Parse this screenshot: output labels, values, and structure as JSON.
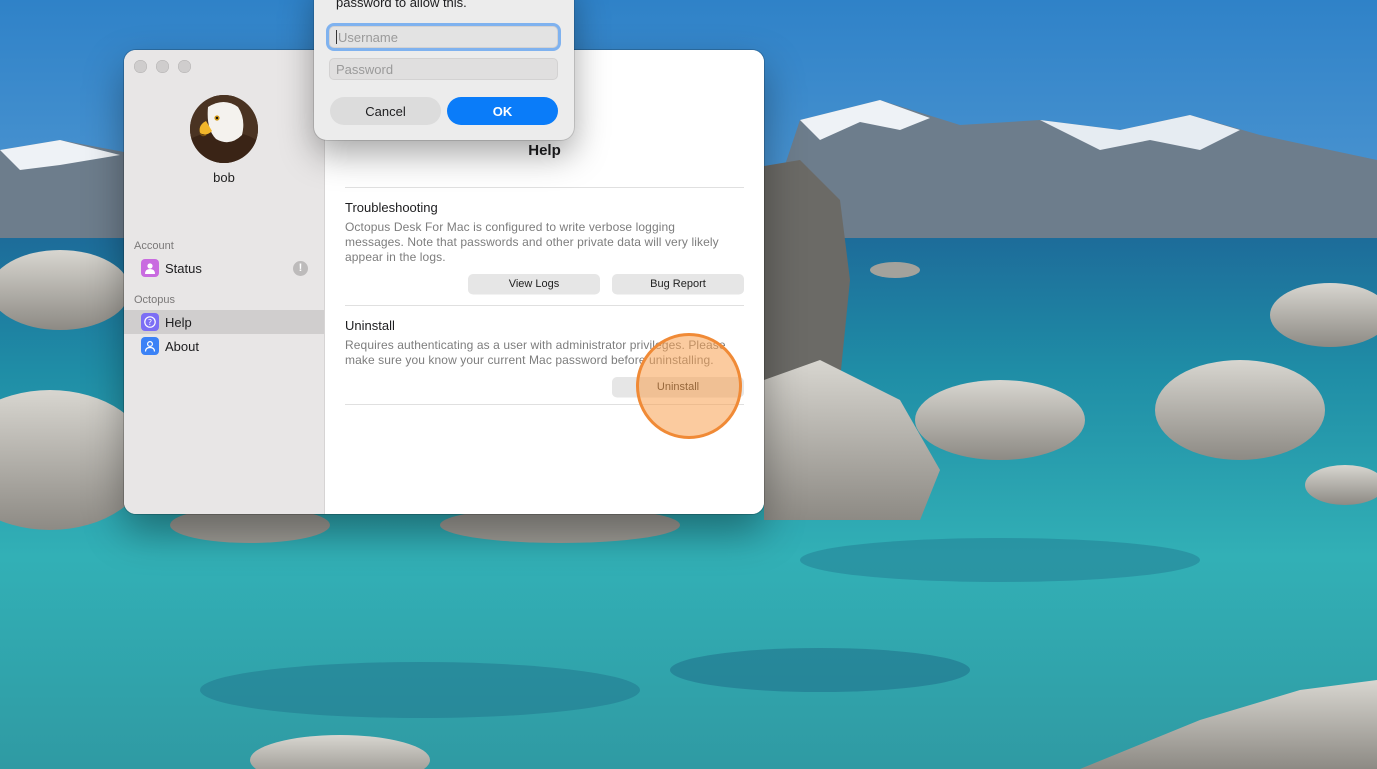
{
  "desktop": {
    "wallpaper": "lake-with-boulders-and-snowy-mountains"
  },
  "window": {
    "profile": {
      "username": "bob",
      "avatar_icon": "eagle-avatar"
    },
    "sidebar": {
      "sections": [
        {
          "label": "Account",
          "items": [
            {
              "label": "Status",
              "icon": "person-icon",
              "icon_color": "#c96be0",
              "badge": "!"
            }
          ]
        },
        {
          "label": "Octopus",
          "items": [
            {
              "label": "Help",
              "icon": "question-icon",
              "icon_color": "#7c6ef5",
              "selected": true
            },
            {
              "label": "About",
              "icon": "person-circle-icon",
              "icon_color": "#3b82f6"
            }
          ]
        }
      ]
    },
    "main": {
      "title": "Help",
      "troubleshooting": {
        "heading": "Troubleshooting",
        "line1": "Octopus Desk For Mac is configured to write verbose logging",
        "line2": "messages. Note that passwords and other private data will very likely",
        "line3": "appear in the logs.",
        "view_logs_label": "View Logs",
        "bug_report_label": "Bug Report"
      },
      "uninstall": {
        "heading": "Uninstall",
        "line1": "Requires authenticating as a user with administrator privileges. Please",
        "line2": "make sure you know your current Mac password before uninstalling.",
        "button_label": "Uninstall"
      }
    }
  },
  "auth_dialog": {
    "message": "password to allow this.",
    "username_placeholder": "Username",
    "password_placeholder": "Password",
    "cancel_label": "Cancel",
    "ok_label": "OK",
    "accent": "#0a7cf9"
  }
}
